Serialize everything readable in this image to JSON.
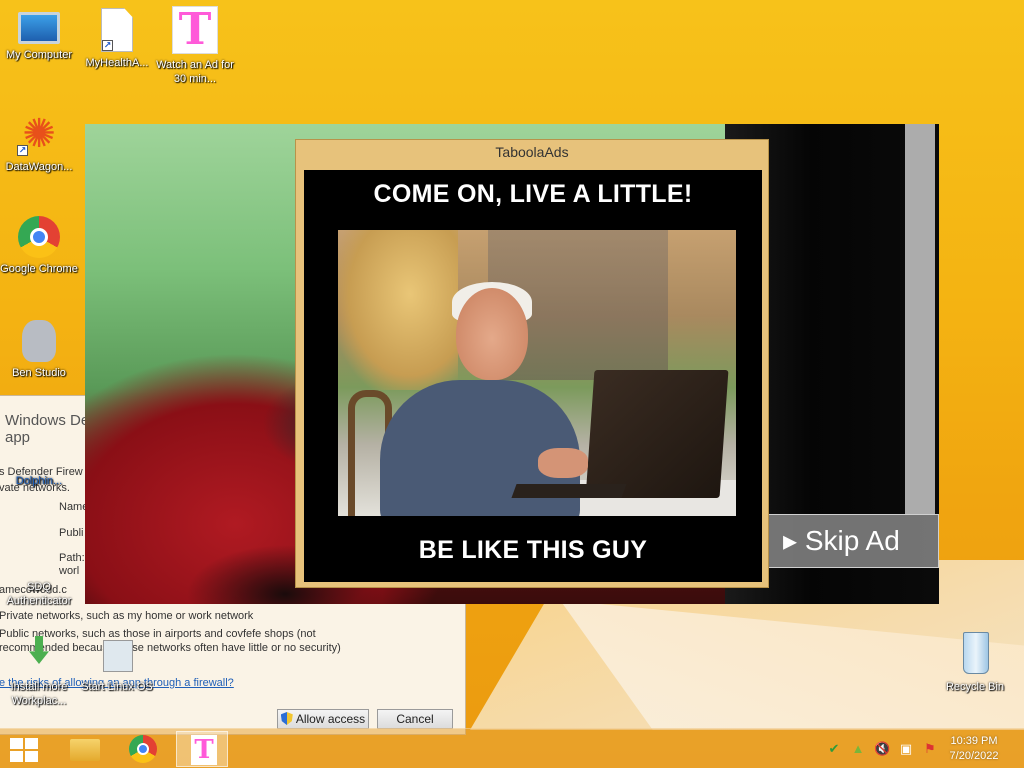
{
  "desktop": {
    "icons": [
      {
        "label": "My Computer"
      },
      {
        "label": "MyHealthA..."
      },
      {
        "label": "Watch an Ad for 30 min..."
      },
      {
        "label": "DataWagon..."
      },
      {
        "label": "Google Chrome"
      },
      {
        "label": "Ben Studio"
      },
      {
        "label": "Dolphin..."
      },
      {
        "label": "SDQ Authenticator"
      },
      {
        "label": "Install more Workplac..."
      },
      {
        "label": "Start Linux OS"
      },
      {
        "label": "Recycle Bin"
      }
    ]
  },
  "firewall": {
    "title": "Windows De",
    "title2": "app",
    "line1": "s Defender Firew",
    "line2": "vate networks.",
    "name_label": "Name",
    "publisher_label": "Publi",
    "path_label": "Path:",
    "path_value": "worl",
    "game_line": "amecoworld.c",
    "private_line": "Private networks, such as my home or work network",
    "public_line1": "Public networks, such as those in airports and covfefe shops (not",
    "public_line2": "recommended because these networks often have little or no security)",
    "risk_link": "e the risks of allowing an app through a firewall?",
    "allow_button": "Allow access",
    "cancel_button": "Cancel"
  },
  "video_ad": {
    "skip_label": "Skip Ad",
    "skip_arrow": "▸"
  },
  "popup": {
    "title": "TaboolaAds",
    "headline_top": "COME ON, LIVE A LITTLE!",
    "headline_bottom": "BE LIKE THIS GUY",
    "accent_color": "#e7c27b"
  },
  "taskbar": {
    "time": "10:39 PM",
    "date": "7/20/2022",
    "tray_icons": [
      "shield-check-icon",
      "network-warning-icon",
      "volume-muted-icon",
      "network-icon",
      "action-center-icon"
    ]
  }
}
